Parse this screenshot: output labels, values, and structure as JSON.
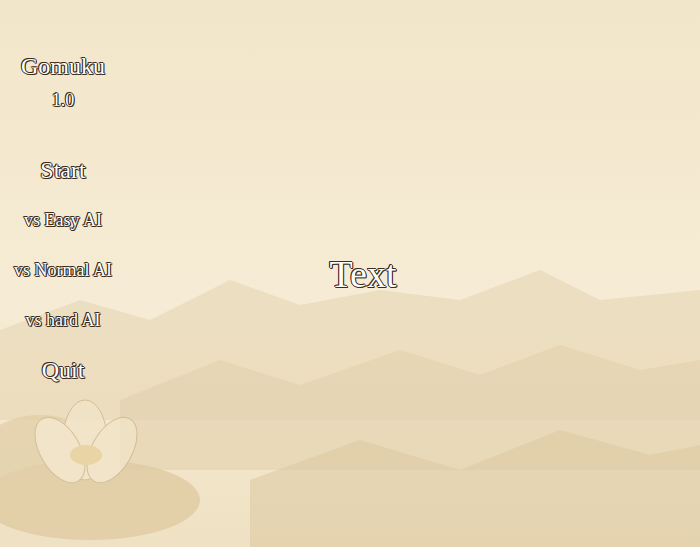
{
  "title": "Gomuku",
  "version": "1.0",
  "menu": [
    {
      "label": "Start",
      "kind": "major"
    },
    {
      "label": "vs Easy AI",
      "kind": "option"
    },
    {
      "label": "vs Normal AI",
      "kind": "option"
    },
    {
      "label": "vs hard AI",
      "kind": "option"
    },
    {
      "label": "Quit",
      "kind": "major"
    }
  ],
  "message": "Text"
}
